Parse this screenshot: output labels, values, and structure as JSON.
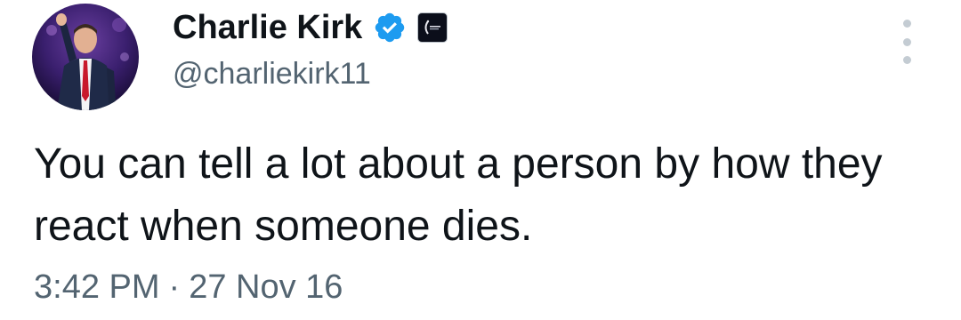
{
  "author": {
    "display_name": "Charlie Kirk",
    "handle": "@charliekirk11",
    "verified": true,
    "verified_color": "#1d9bf0",
    "affiliate_badge_icon": "organization-logo-icon"
  },
  "tweet": {
    "text": "You can tell a lot about a person by how they react when someone dies."
  },
  "meta": {
    "time": "3:42 PM",
    "separator": "·",
    "date": "27 Nov 16"
  },
  "icons": {
    "more": "more-options-icon"
  },
  "colors": {
    "text_primary": "#0f1419",
    "text_secondary": "#536471",
    "background": "#ffffff"
  }
}
